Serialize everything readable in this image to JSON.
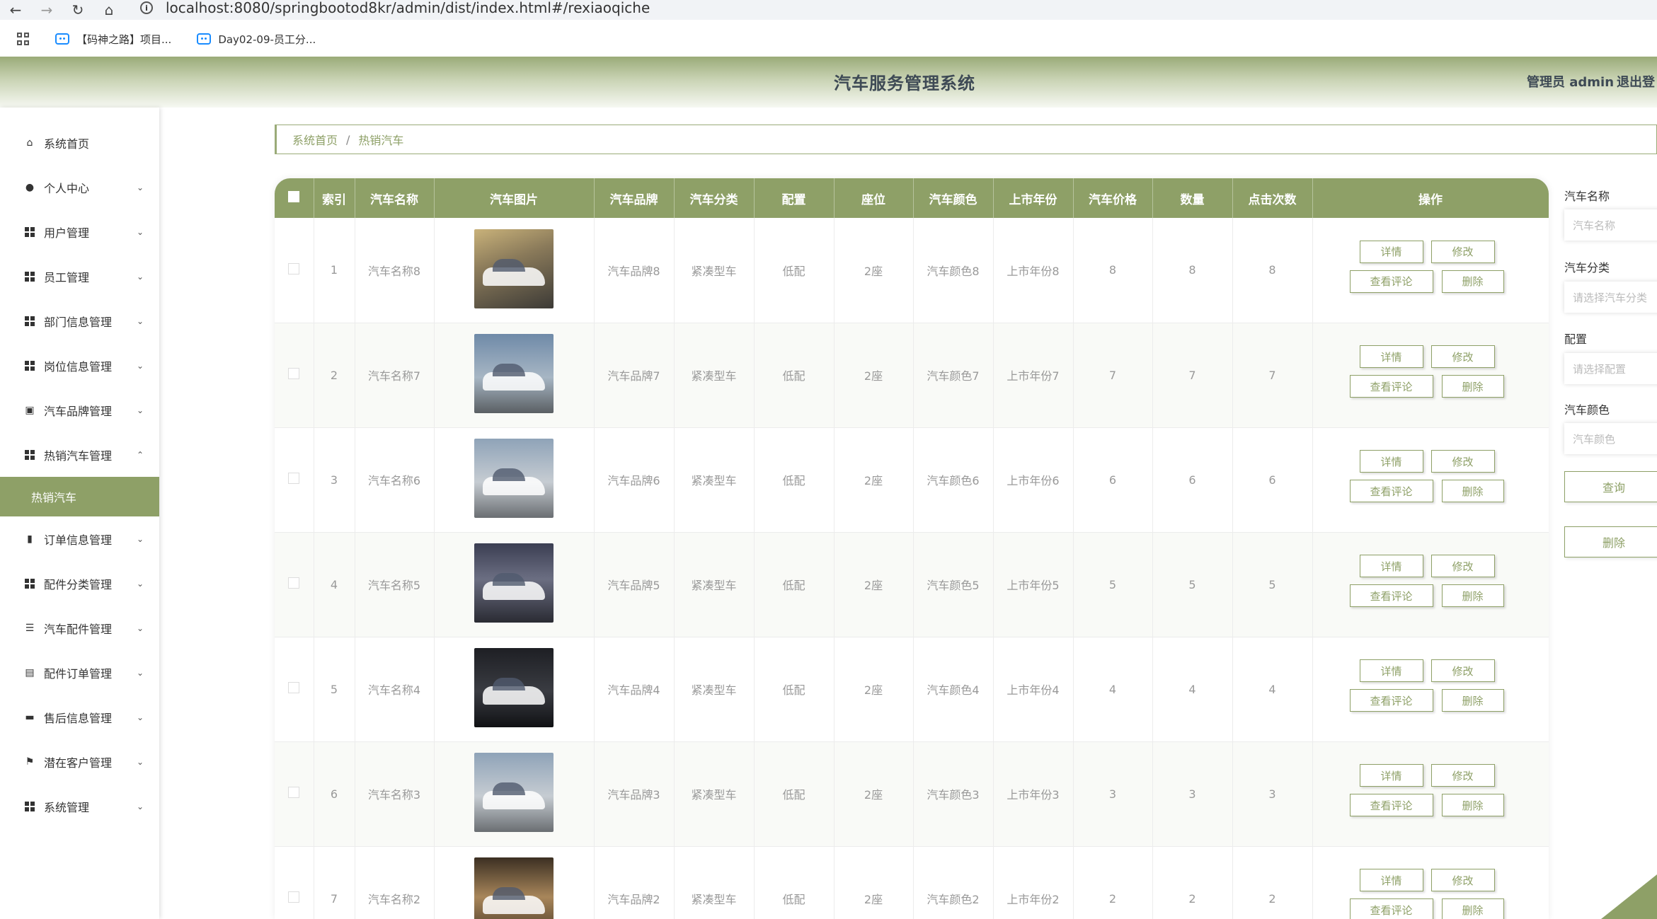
{
  "browser": {
    "url": "localhost:8080/springbootod8kr/admin/dist/index.html#/rexiaoqiche",
    "bookmarks": [
      "【码神之路】项目...",
      "Day02-09-员工分..."
    ]
  },
  "header": {
    "title": "汽车服务管理系统",
    "user": "管理员 admin",
    "logout": "退出登"
  },
  "sidebar": {
    "items": [
      {
        "label": "系统首页"
      },
      {
        "label": "个人中心"
      },
      {
        "label": "用户管理"
      },
      {
        "label": "员工管理"
      },
      {
        "label": "部门信息管理"
      },
      {
        "label": "岗位信息管理"
      },
      {
        "label": "汽车品牌管理"
      },
      {
        "label": "热销汽车管理"
      },
      {
        "label": "订单信息管理"
      },
      {
        "label": "配件分类管理"
      },
      {
        "label": "汽车配件管理"
      },
      {
        "label": "配件订单管理"
      },
      {
        "label": "售后信息管理"
      },
      {
        "label": "潜在客户管理"
      },
      {
        "label": "系统管理"
      }
    ],
    "active_sub": "热销汽车"
  },
  "breadcrumb": {
    "home": "系统首页",
    "sep": "/",
    "current": "热销汽车"
  },
  "table": {
    "columns": [
      "索引",
      "汽车名称",
      "汽车图片",
      "汽车品牌",
      "汽车分类",
      "配置",
      "座位",
      "汽车颜色",
      "上市年份",
      "汽车价格",
      "数量",
      "点击次数",
      "操作"
    ],
    "buttons": {
      "detail": "详情",
      "edit": "修改",
      "comment": "查看评论",
      "delete": "删除"
    },
    "rows": [
      {
        "index": "1",
        "name": "汽车名称8",
        "brand": "汽车品牌8",
        "category": "紧凑型车",
        "config": "低配",
        "seats": "2座",
        "color": "汽车颜色8",
        "year": "上市年份8",
        "price": "8",
        "qty": "8",
        "clicks": "8"
      },
      {
        "index": "2",
        "name": "汽车名称7",
        "brand": "汽车品牌7",
        "category": "紧凑型车",
        "config": "低配",
        "seats": "2座",
        "color": "汽车颜色7",
        "year": "上市年份7",
        "price": "7",
        "qty": "7",
        "clicks": "7"
      },
      {
        "index": "3",
        "name": "汽车名称6",
        "brand": "汽车品牌6",
        "category": "紧凑型车",
        "config": "低配",
        "seats": "2座",
        "color": "汽车颜色6",
        "year": "上市年份6",
        "price": "6",
        "qty": "6",
        "clicks": "6"
      },
      {
        "index": "4",
        "name": "汽车名称5",
        "brand": "汽车品牌5",
        "category": "紧凑型车",
        "config": "低配",
        "seats": "2座",
        "color": "汽车颜色5",
        "year": "上市年份5",
        "price": "5",
        "qty": "5",
        "clicks": "5"
      },
      {
        "index": "5",
        "name": "汽车名称4",
        "brand": "汽车品牌4",
        "category": "紧凑型车",
        "config": "低配",
        "seats": "2座",
        "color": "汽车颜色4",
        "year": "上市年份4",
        "price": "4",
        "qty": "4",
        "clicks": "4"
      },
      {
        "index": "6",
        "name": "汽车名称3",
        "brand": "汽车品牌3",
        "category": "紧凑型车",
        "config": "低配",
        "seats": "2座",
        "color": "汽车颜色3",
        "year": "上市年份3",
        "price": "3",
        "qty": "3",
        "clicks": "3"
      },
      {
        "index": "7",
        "name": "汽车名称2",
        "brand": "汽车品牌2",
        "category": "紧凑型车",
        "config": "低配",
        "seats": "2座",
        "color": "汽车颜色2",
        "year": "上市年份2",
        "price": "2",
        "qty": "2",
        "clicks": "2"
      }
    ]
  },
  "search": {
    "name_label": "汽车名称",
    "name_placeholder": "汽车名称",
    "category_label": "汽车分类",
    "category_placeholder": "请选择汽车分类",
    "config_label": "配置",
    "config_placeholder": "请选择配置",
    "color_label": "汽车颜色",
    "color_placeholder": "汽车颜色",
    "query_button": "查询",
    "delete_button": "删除"
  },
  "colors": {
    "accent": "#8ea067",
    "header_dark": "#9aab78"
  }
}
